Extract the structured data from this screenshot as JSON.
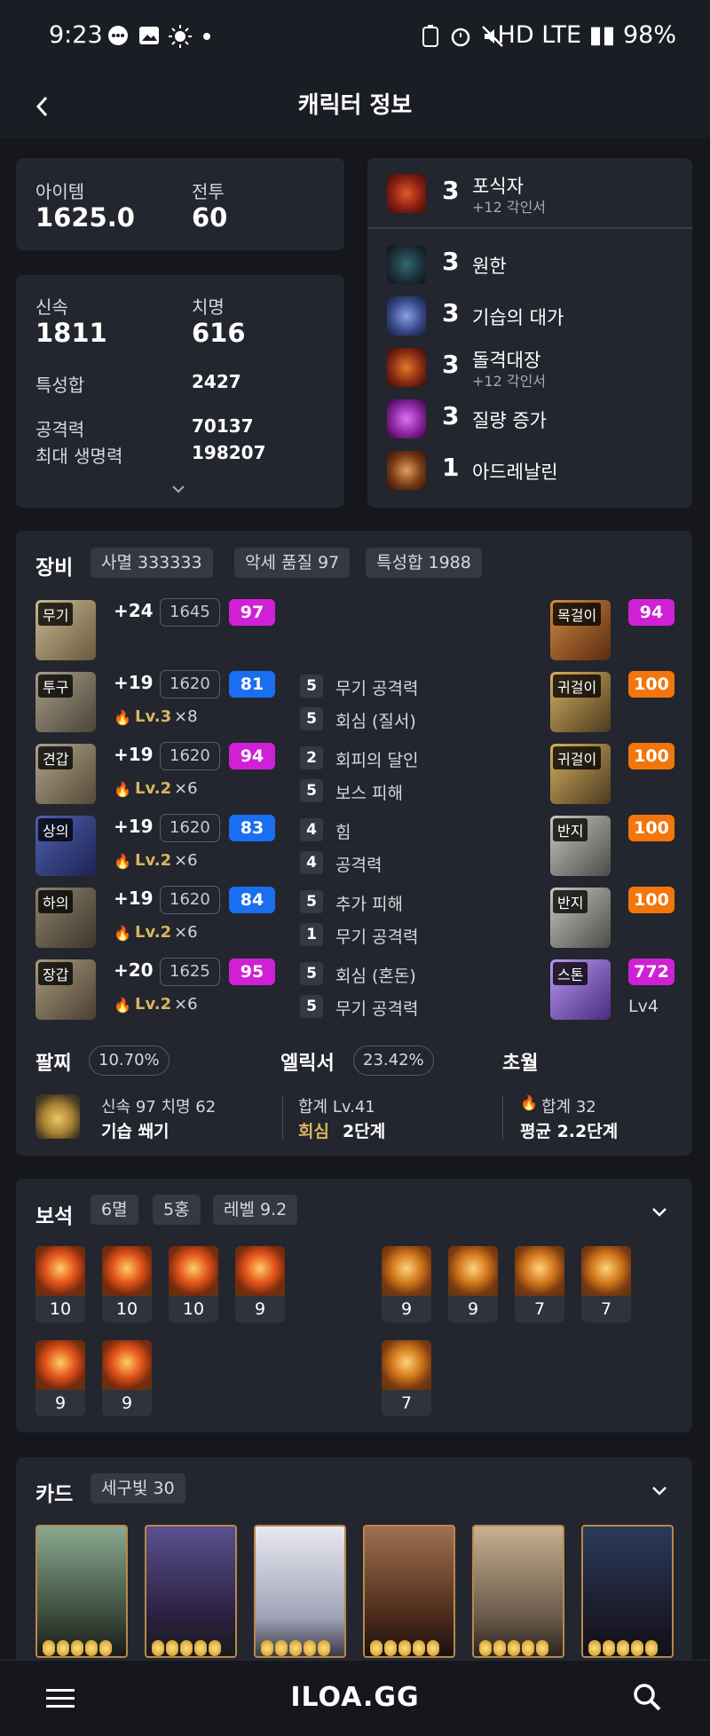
{
  "status_bar": {
    "time": "9:23",
    "right": "HD LTE ▮▮ 98%"
  },
  "header": {
    "title": "캐릭터 정보"
  },
  "summary": {
    "item_label": "아이템",
    "item_value": "1625.0",
    "battle_label": "전투",
    "battle_value": "60"
  },
  "stats": {
    "swift_label": "신속",
    "swift_value": "1811",
    "crit_label": "치명",
    "crit_value": "616",
    "total_label": "특성합",
    "total_value": "2427",
    "atk_label": "공격력",
    "atk_value": "70137",
    "hp_label": "최대 생명력",
    "hp_value": "198207"
  },
  "engravings": [
    {
      "num": "3",
      "name": "포식자",
      "sub": "+12 각인서"
    },
    {
      "num": "3",
      "name": "원한",
      "sub": ""
    },
    {
      "num": "3",
      "name": "기습의 대가",
      "sub": ""
    },
    {
      "num": "3",
      "name": "돌격대장",
      "sub": "+12 각인서"
    },
    {
      "num": "3",
      "name": "질량 증가",
      "sub": ""
    },
    {
      "num": "1",
      "name": "아드레날린",
      "sub": ""
    }
  ],
  "equipment": {
    "title": "장비",
    "chips": [
      "사멸 333333",
      "악세 품질 97",
      "특성합 1988"
    ],
    "left": [
      {
        "slot": "무기",
        "plus": "+24",
        "ilvl": "1645",
        "quality": "97",
        "qcolor": "pink",
        "lv": "",
        "mult": ""
      },
      {
        "slot": "투구",
        "plus": "+19",
        "ilvl": "1620",
        "quality": "81",
        "qcolor": "blue",
        "lv": "Lv.3",
        "mult": "×8"
      },
      {
        "slot": "견갑",
        "plus": "+19",
        "ilvl": "1620",
        "quality": "94",
        "qcolor": "pink",
        "lv": "Lv.2",
        "mult": "×6"
      },
      {
        "slot": "상의",
        "plus": "+19",
        "ilvl": "1620",
        "quality": "83",
        "qcolor": "blue",
        "lv": "Lv.2",
        "mult": "×6"
      },
      {
        "slot": "하의",
        "plus": "+19",
        "ilvl": "1620",
        "quality": "84",
        "qcolor": "blue",
        "lv": "Lv.2",
        "mult": "×6"
      },
      {
        "slot": "장갑",
        "plus": "+20",
        "ilvl": "1625",
        "quality": "95",
        "qcolor": "pink",
        "lv": "Lv.2",
        "mult": "×6"
      }
    ],
    "engrave_lines": [
      {
        "n": "5",
        "t": "무기 공격력"
      },
      {
        "n": "5",
        "t": "회심 (질서)"
      },
      {
        "n": "2",
        "t": "회피의 달인"
      },
      {
        "n": "5",
        "t": "보스 피해"
      },
      {
        "n": "4",
        "t": "힘"
      },
      {
        "n": "4",
        "t": "공격력"
      },
      {
        "n": "5",
        "t": "추가 피해"
      },
      {
        "n": "1",
        "t": "무기 공격력"
      },
      {
        "n": "5",
        "t": "회심 (혼돈)"
      },
      {
        "n": "5",
        "t": "무기 공격력"
      }
    ],
    "right": [
      {
        "slot": "목걸이",
        "quality": "94",
        "qcolor": "pink"
      },
      {
        "slot": "귀걸이",
        "quality": "100",
        "qcolor": "orange"
      },
      {
        "slot": "귀걸이",
        "quality": "100",
        "qcolor": "orange"
      },
      {
        "slot": "반지",
        "quality": "100",
        "qcolor": "orange"
      },
      {
        "slot": "반지",
        "quality": "100",
        "qcolor": "orange"
      },
      {
        "slot": "스톤",
        "quality": "772",
        "qcolor": "pink",
        "extra": "Lv4"
      }
    ]
  },
  "bracelet": {
    "title": "팔찌",
    "pct": "10.70%",
    "line1": "신속 97  치명 62",
    "line2": "기습  쐐기"
  },
  "elixir": {
    "title": "엘릭서",
    "pct": "23.42%",
    "line1": "합계 Lv.41",
    "line2a": "회심",
    "line2b": "2단계"
  },
  "transcend": {
    "title": "초월",
    "line1": "합계 32",
    "line2": "평균 2.2단계"
  },
  "gems": {
    "title": "보석",
    "chips": [
      "6멸",
      "5홍",
      "레벨 9.2"
    ],
    "red_row1": [
      "10",
      "10",
      "10",
      "9"
    ],
    "red_row2": [
      "9",
      "9"
    ],
    "blue_row1": [
      "9",
      "9",
      "7",
      "7"
    ],
    "blue_row2": [
      "7"
    ]
  },
  "cards": {
    "title": "카드",
    "chip": "세구빛 30"
  },
  "bottom_nav": {
    "logo": "ILOA.GG"
  },
  "colors": {
    "pink": "#d020d6",
    "blue": "#1a6ef0",
    "orange": "#f2760c",
    "bg": "#15171d",
    "panel": "#23262e"
  }
}
